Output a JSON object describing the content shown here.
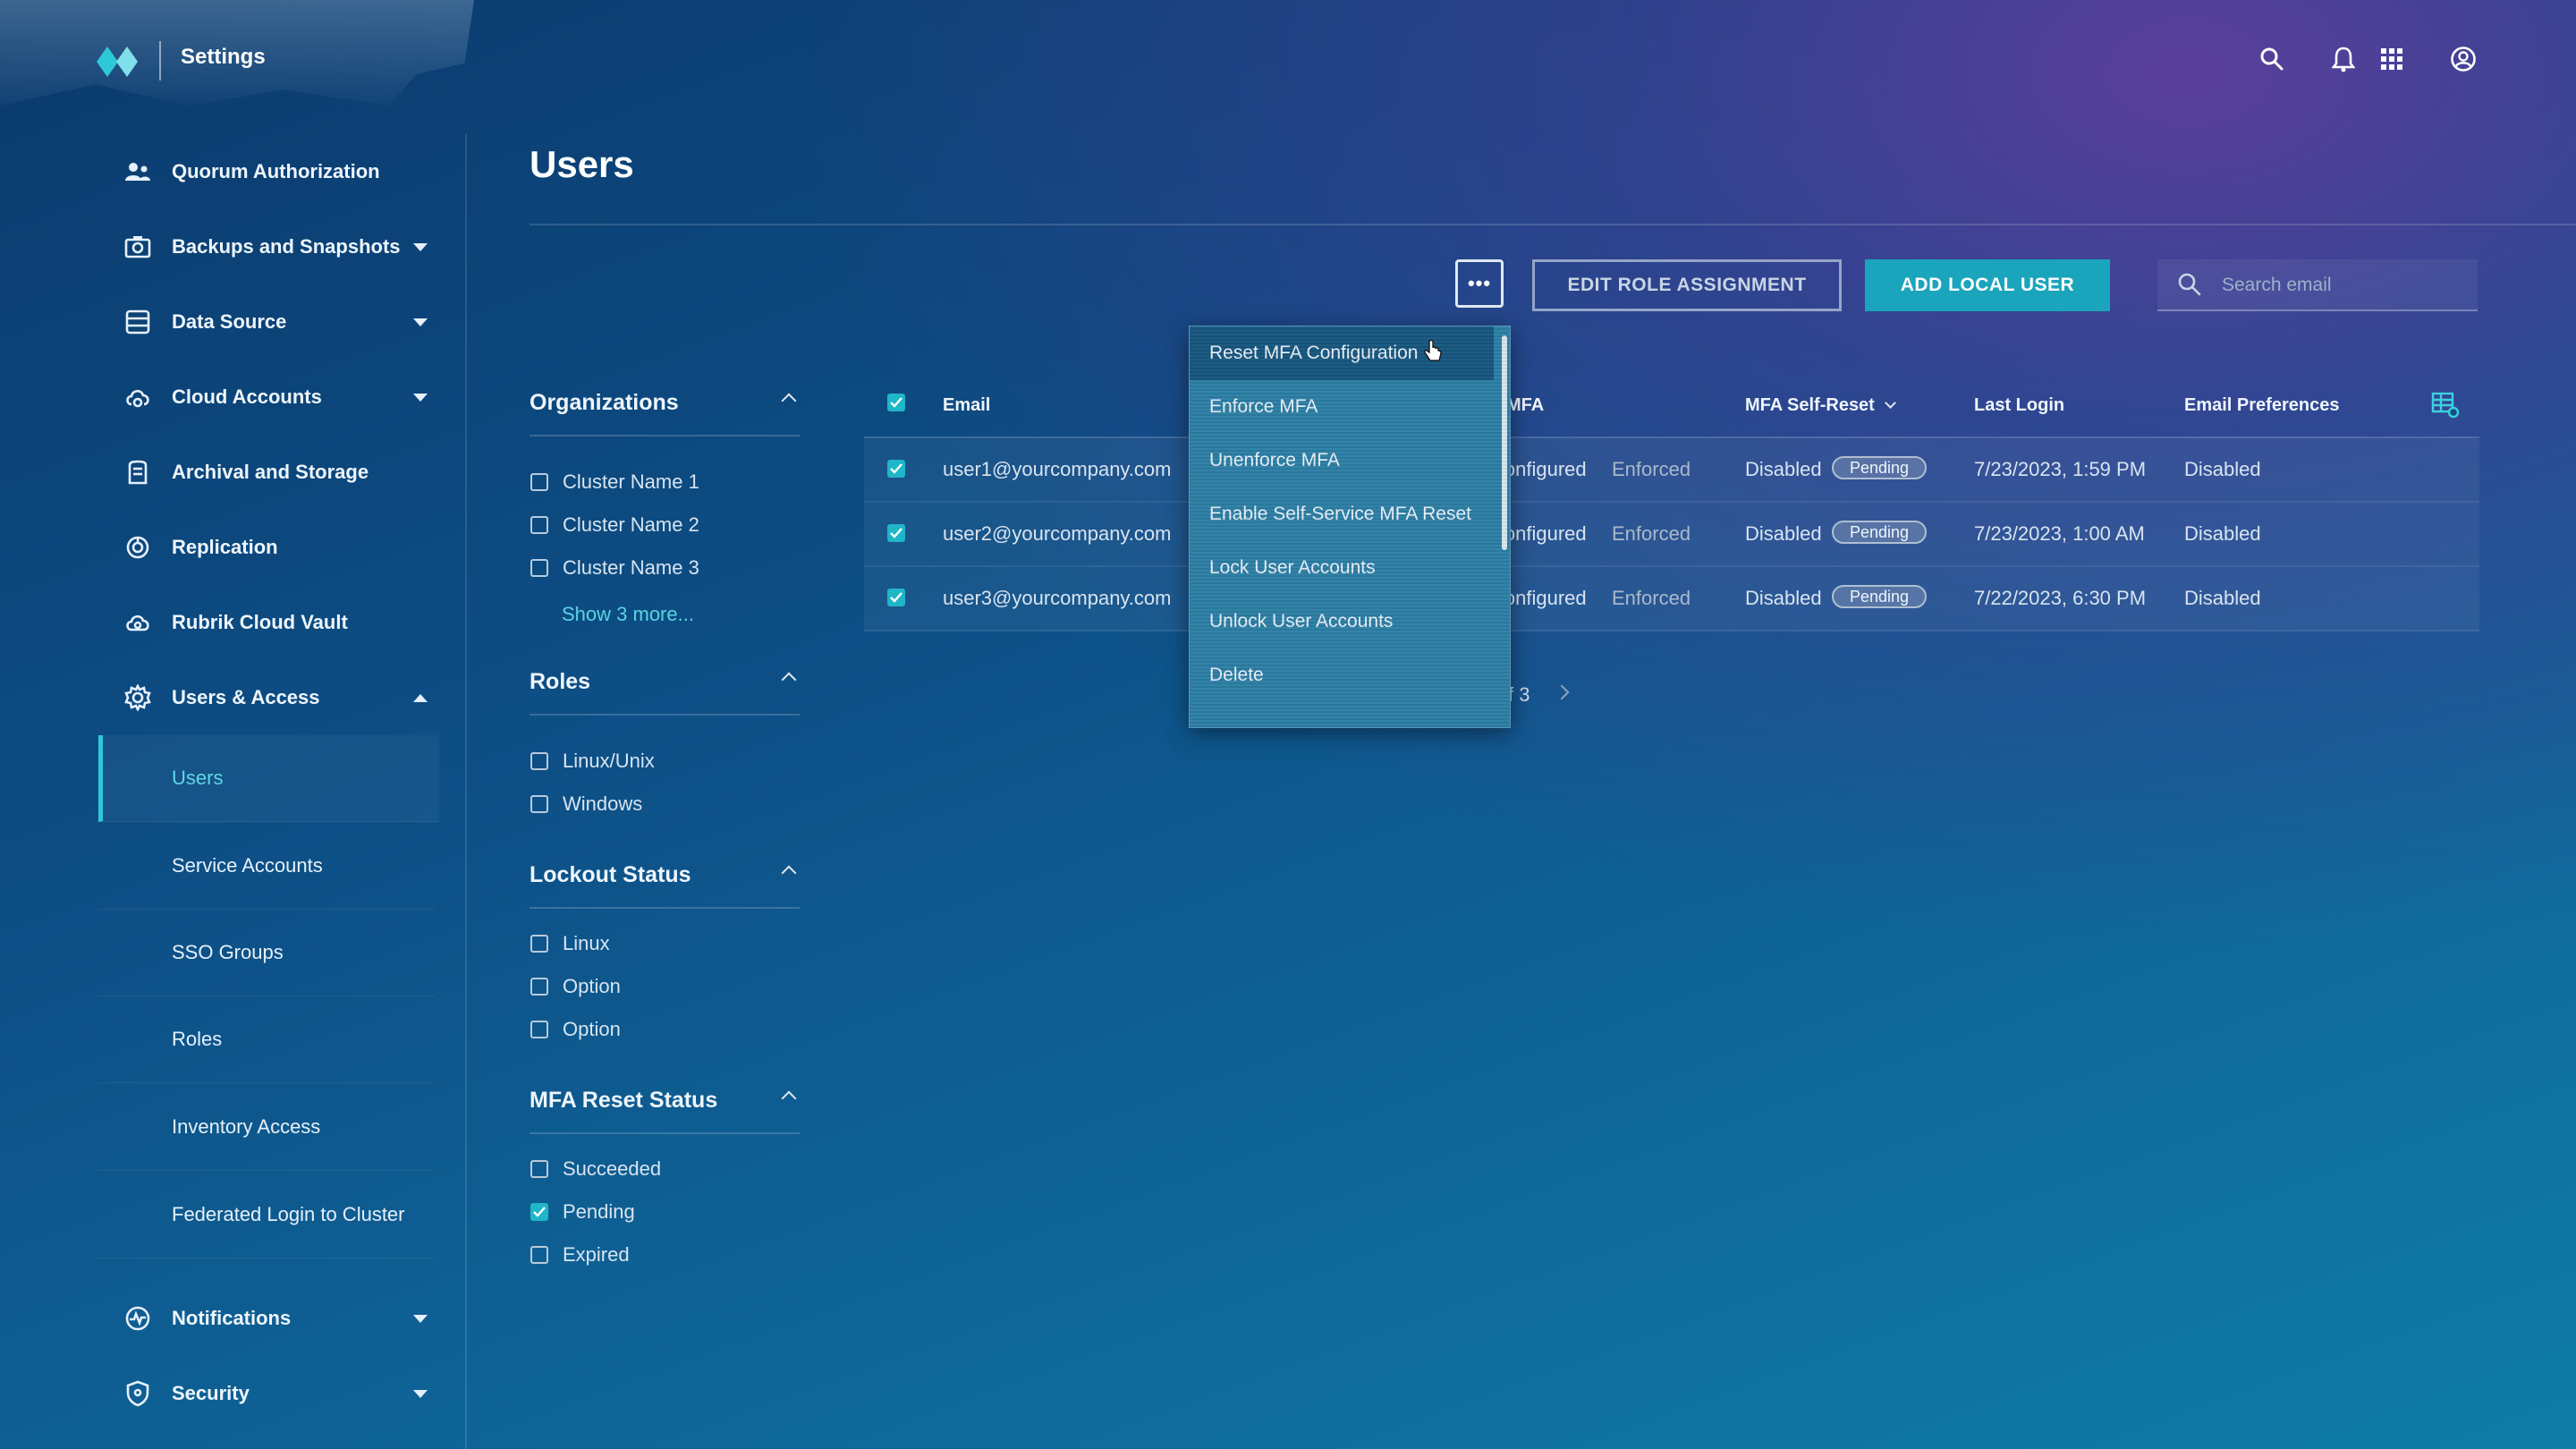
{
  "header": {
    "app_title": "Settings"
  },
  "icons": {
    "search": "search-icon",
    "notifications": "bell-icon",
    "apps": "grid-icon",
    "profile": "user-circle-icon"
  },
  "sidebar": {
    "items": [
      {
        "label": "Quorum Authorization",
        "icon": "quorum-icon"
      },
      {
        "label": "Backups and Snapshots",
        "icon": "camera-icon",
        "expandable": true
      },
      {
        "label": "Data Source",
        "icon": "database-icon",
        "expandable": true
      },
      {
        "label": "Cloud Accounts",
        "icon": "cloud-gear-icon",
        "expandable": true
      },
      {
        "label": "Archival and Storage",
        "icon": "archive-icon"
      },
      {
        "label": "Replication",
        "icon": "replication-icon"
      },
      {
        "label": "Rubrik Cloud Vault",
        "icon": "cloud-vault-icon"
      },
      {
        "label": "Users & Access",
        "icon": "gear-icon",
        "expanded": true
      },
      {
        "label": "Notifications",
        "icon": "pulse-icon",
        "expandable": true
      },
      {
        "label": "Security",
        "icon": "shield-icon",
        "expandable": true
      }
    ],
    "sub_items": [
      "Users",
      "Service Accounts",
      "SSO Groups",
      "Roles",
      "Inventory Access",
      "Federated Login to Cluster"
    ],
    "active_sub": "Users"
  },
  "page": {
    "title": "Users"
  },
  "toolbar": {
    "more_label": "•••",
    "edit_role_label": "EDIT ROLE ASSIGNMENT",
    "add_user_label": "ADD LOCAL USER",
    "search_placeholder": "Search email"
  },
  "filters": {
    "organizations": {
      "title": "Organizations",
      "options": [
        "Cluster Name 1",
        "Cluster Name 2",
        "Cluster Name 3"
      ],
      "show_more": "Show 3 more..."
    },
    "roles": {
      "title": "Roles",
      "options": [
        "Linux/Unix",
        "Windows"
      ]
    },
    "lockout": {
      "title": "Lockout Status",
      "options": [
        "Linux",
        "Option",
        "Option"
      ]
    },
    "mfa_reset": {
      "title": "MFA Reset Status",
      "options": [
        "Succeeded",
        "Pending",
        "Expired"
      ],
      "checked": "Pending"
    }
  },
  "table": {
    "headers": {
      "email": "Email",
      "mfa": "MFA",
      "mfa_self_reset": "MFA Self-Reset",
      "last_login": "Last Login",
      "email_prefs": "Email Preferences"
    },
    "rows": [
      {
        "email": "user1@yourcompany.com",
        "mfa": "Configured",
        "mfa_status": "Enforced",
        "self_reset": "Disabled",
        "badge": "Pending",
        "last_login": "7/23/2023, 1:59 PM",
        "email_prefs": "Disabled"
      },
      {
        "email": "user2@yourcompany.com",
        "mfa": "Configured",
        "mfa_status": "Enforced",
        "self_reset": "Disabled",
        "badge": "Pending",
        "last_login": "7/23/2023, 1:00 AM",
        "email_prefs": "Disabled"
      },
      {
        "email": "user3@yourcompany.com",
        "mfa": "Configured",
        "mfa_status": "Enforced",
        "self_reset": "Disabled",
        "badge": "Pending",
        "last_login": "7/22/2023, 6:30 PM",
        "email_prefs": "Disabled"
      }
    ],
    "pager": "f 3"
  },
  "menu": {
    "items": [
      "Reset MFA Configuration",
      "Enforce MFA",
      "Unenforce MFA",
      "Enable Self-Service MFA Reset",
      "Lock User Accounts",
      "Unlock User Accounts",
      "Delete"
    ],
    "hovered": "Reset MFA Configuration"
  },
  "colors": {
    "accent": "#1aa5bc",
    "active": "#5ed8e4",
    "menu_bg": "#2d7fa6"
  }
}
